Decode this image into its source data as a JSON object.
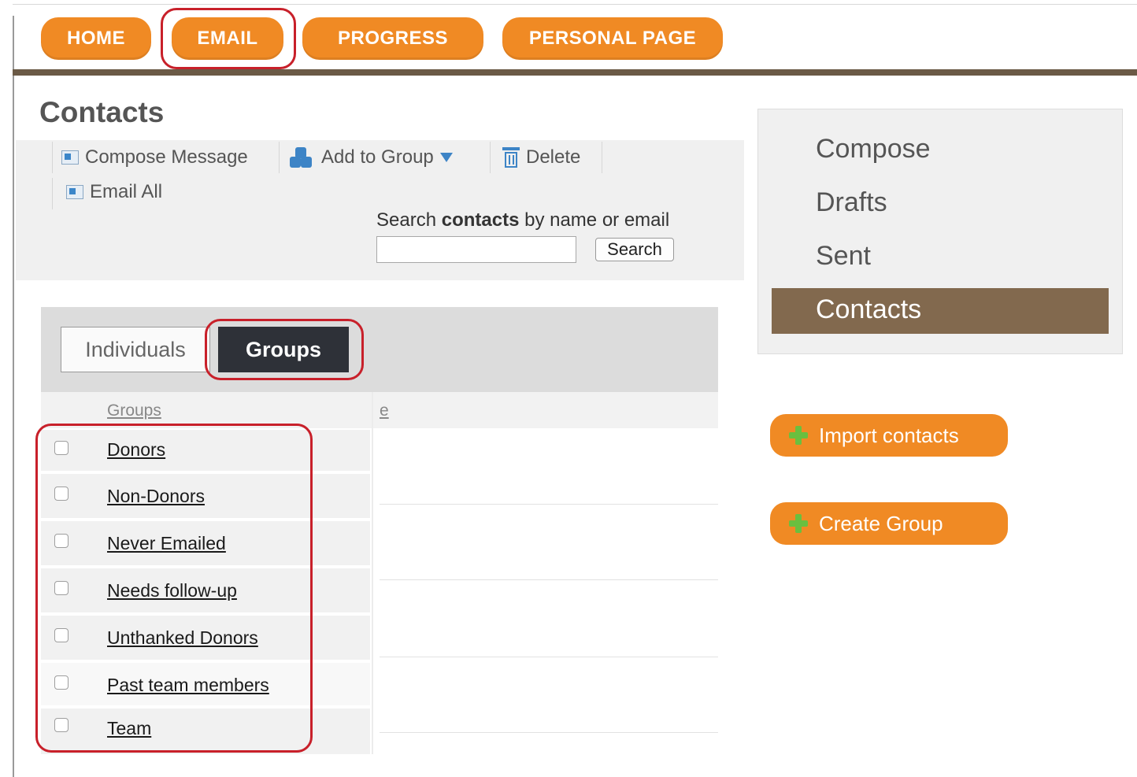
{
  "nav": {
    "items": [
      {
        "label": "HOME"
      },
      {
        "label": "EMAIL"
      },
      {
        "label": "PROGRESS"
      },
      {
        "label": "PERSONAL PAGE"
      }
    ]
  },
  "page": {
    "title": "Contacts"
  },
  "toolbar": {
    "compose_label": "Compose Message",
    "add_group_label": "Add to Group",
    "delete_label": "Delete",
    "email_all_label": "Email All"
  },
  "search": {
    "label_prefix": "Search",
    "label_bold": "contacts",
    "label_suffix": "by name or email",
    "value": "",
    "placeholder": "",
    "button_label": "Search"
  },
  "tabs": {
    "individuals": "Individuals",
    "groups": "Groups",
    "active": "Groups"
  },
  "table": {
    "headers": [
      "Groups",
      "e"
    ],
    "rows": [
      {
        "label": "Donors",
        "checked": false
      },
      {
        "label": "Non-Donors",
        "checked": false
      },
      {
        "label": "Never Emailed",
        "checked": false
      },
      {
        "label": "Needs follow-up",
        "checked": false
      },
      {
        "label": "Unthanked Donors",
        "checked": false
      },
      {
        "label": "Past team members",
        "checked": false
      },
      {
        "label": "Team",
        "checked": false
      }
    ]
  },
  "sidebar": {
    "items": [
      {
        "label": "Compose"
      },
      {
        "label": "Drafts"
      },
      {
        "label": "Sent"
      },
      {
        "label": "Contacts"
      }
    ],
    "active": "Contacts"
  },
  "actions": {
    "import_label": "Import contacts",
    "create_group_label": "Create Group"
  },
  "colors": {
    "accent": "#f08a24",
    "nav_bar": "#6b5a46",
    "sidebar_active": "#82694e",
    "highlight": "#c8202a",
    "tab_active": "#2e3138"
  }
}
